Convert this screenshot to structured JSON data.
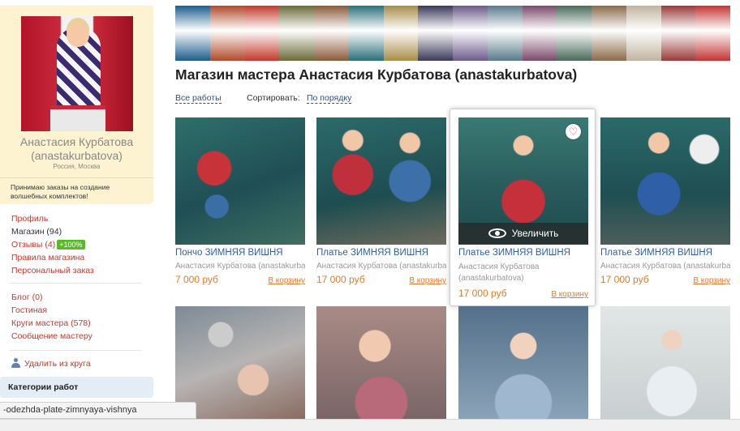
{
  "sidebar": {
    "profile_name": "Анастасия Курбатова (anastakurbatova)",
    "profile_city": "Россия, Москва",
    "profile_note": "Принимаю заказы на создание волшебных комплектов!",
    "menu1": {
      "profile": "Профиль",
      "shop": "Магазин (94)",
      "reviews": "Отзывы (4)",
      "reviews_badge": "+100%",
      "rules": "Правила магазина",
      "personal_order": "Персональный заказ"
    },
    "menu2": {
      "blog": "Блог (0)",
      "guestroom": "Гостиная",
      "circles": "Круги мастера (578)",
      "message": "Сообщение мастеру"
    },
    "remove_circle": "Удалить из круга",
    "categories": "Категории работ"
  },
  "banner_colors": [
    "#1e5d8c",
    "#b04a2a",
    "#c23a2c",
    "#6b6b3a",
    "#8a5a3a",
    "#2c6f7a",
    "#a88c4a",
    "#3a3a5a",
    "#6a5a8a",
    "#5a7a8a",
    "#7a4a6a",
    "#4a6a5a",
    "#8a6a4a",
    "#c0b4a0",
    "#9a3a3a",
    "#c43434"
  ],
  "main": {
    "title": "Магазин мастера Анастасия Курбатова (anastakurbatova)",
    "all_works": "Все работы",
    "sort_label": "Сортировать:",
    "sort_value": "По порядку"
  },
  "products": [
    {
      "title": "Пончо ЗИМНЯЯ ВИШНЯ",
      "author": "Анастасия Курбатова (anastakurbatova)",
      "price": "7 000 руб",
      "cart": "В корзину"
    },
    {
      "title": "Платье ЗИМНЯЯ ВИШНЯ",
      "author": "Анастасия Курбатова (anastakurbatova)",
      "price": "17 000 руб",
      "cart": "В корзину"
    },
    {
      "title": "Платье ЗИМНЯЯ ВИШНЯ",
      "author": "Анастасия Курбатова (anastakurbatova)",
      "price": "17 000 руб",
      "cart": "В корзину",
      "zoom": "Увеличить"
    },
    {
      "title": "Платье ЗИМНЯЯ ВИШНЯ",
      "author": "Анастасия Курбатова (anastakurbatova)",
      "price": "17 000 руб",
      "cart": "В корзину"
    }
  ],
  "status_url": "-odezhda-plate-zimnyaya-vishnya",
  "colors": {
    "link_red": "#c5392d",
    "link_blue": "#2f5ea7",
    "price_orange": "#e07a2a",
    "profile_bg": "#fdf3d0",
    "badge_green": "#5cb82b"
  }
}
